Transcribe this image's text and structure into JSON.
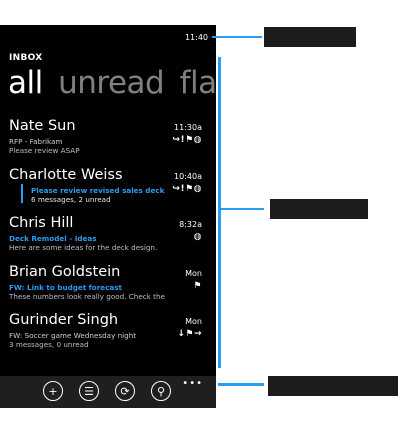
{
  "status": {
    "time": "11:40"
  },
  "inbox": {
    "title": "INBOX"
  },
  "pivots": [
    "all",
    "unread",
    "flagged"
  ],
  "messages": [
    {
      "sender": "Nate Sun",
      "time": "11:30a",
      "subject": "RFP - Fabrikam",
      "preview": "Please review ASAP",
      "flags": "↪!⚑◍",
      "subject_style": "white",
      "threaded": false
    },
    {
      "sender": "Charlotte Weiss",
      "time": "10:40a",
      "subject": "Please review revised sales deck",
      "preview": "6 messages, 2 unread",
      "flags": "↪!⚑◍",
      "subject_style": "blue",
      "threaded": true
    },
    {
      "sender": "Chris Hill",
      "time": "8:32a",
      "subject": "Deck Remodel - Ideas",
      "preview": "Here are some ideas for the deck design.",
      "flags": "◍",
      "subject_style": "blue",
      "threaded": false
    },
    {
      "sender": "Brian Goldstein",
      "time": "Mon",
      "subject": "FW: Link to budget forecast",
      "preview": "These numbers look really good. Check the",
      "flags": "⚑",
      "subject_style": "blue",
      "threaded": false
    },
    {
      "sender": "Gurinder Singh",
      "time": "Mon",
      "subject": "FW: Soccer game Wednesday night",
      "preview": "3 messages, 0 unread",
      "flags": "↓⚑→",
      "subject_style": "white",
      "threaded": false
    }
  ],
  "appbar": {
    "buttons": [
      "+",
      "☰",
      "⟳",
      "⚲"
    ],
    "more": "•••"
  },
  "colors": {
    "accent": "#2b9cf0",
    "background": "#000000",
    "appbar": "#1f1f1f"
  }
}
